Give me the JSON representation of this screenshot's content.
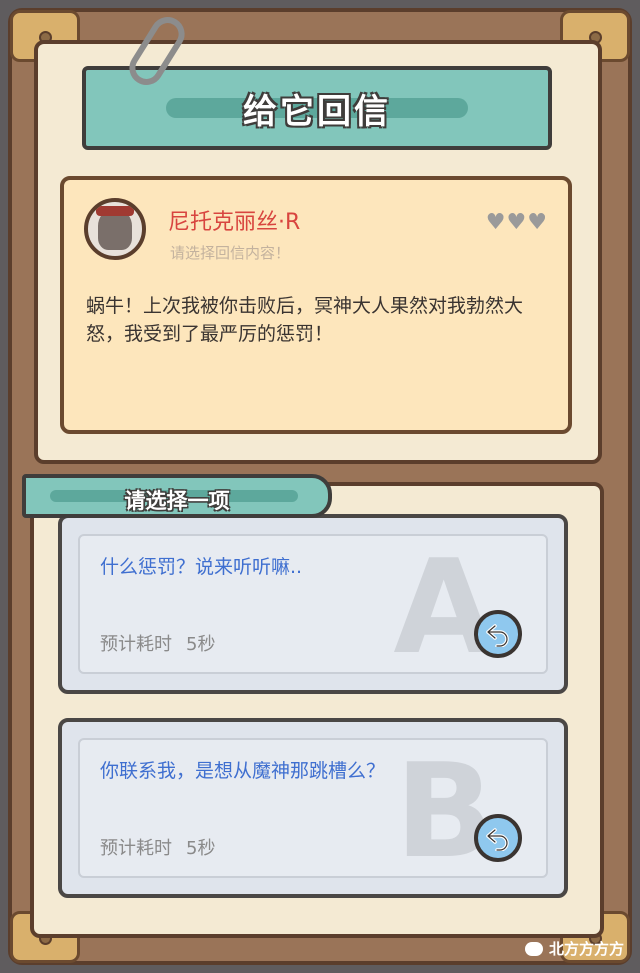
{
  "header": {
    "title": "给它回信"
  },
  "letter": {
    "sender": "尼托克丽丝·R",
    "hint": "请选择回信内容！",
    "hearts": 3,
    "message": "蜗牛！上次我被你击败后，冥神大人果然对我勃然大怒，我受到了最严厉的惩罚！"
  },
  "choices": {
    "prompt": "请选择一项",
    "options": [
      {
        "mark": "A",
        "text": "什么惩罚？说来听听嘛..",
        "time_label": "预计耗时",
        "time_value": "5秒"
      },
      {
        "mark": "B",
        "text": "你联系我，是想从魔神那跳槽么？",
        "time_label": "预计耗时",
        "time_value": "5秒"
      }
    ]
  },
  "icons": {
    "clip": "paperclip-icon",
    "heart": "heart-icon",
    "reply": "reply-arrow-icon",
    "wechat": "wechat-icon"
  },
  "colors": {
    "banner": "#82c6bb",
    "sender": "#d8453f",
    "option_text": "#3f6fd0",
    "reply_button": "#8fc8ee"
  },
  "watermark": "北方方方方"
}
